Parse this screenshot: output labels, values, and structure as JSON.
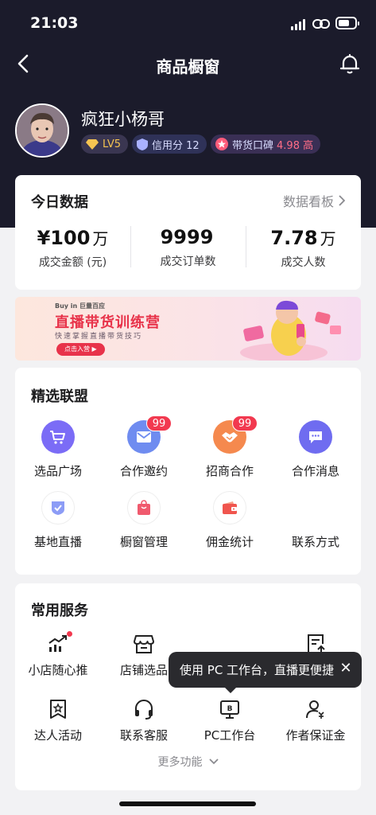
{
  "status_bar": {
    "time": "21:03"
  },
  "nav": {
    "title": "商品橱窗"
  },
  "profile": {
    "name": "疯狂小杨哥",
    "level": "LV5",
    "credit": "信用分 12",
    "reputation_label": "带货口碑",
    "reputation_score": "4.98 高"
  },
  "today": {
    "title": "今日数据",
    "board_link": "数据看板",
    "stats": [
      {
        "value": "¥100",
        "unit": "万",
        "label": "成交金额 (元)"
      },
      {
        "value": "9999",
        "unit": "",
        "label": "成交订单数"
      },
      {
        "value": "7.78",
        "unit": "万",
        "label": "成交人数"
      }
    ]
  },
  "banner": {
    "brand": "Buy in 巨量百应",
    "headline": "直播带货训练营",
    "subtitle": "快速掌握直播带货技巧",
    "cta": "点击入营 ▶"
  },
  "alliance": {
    "title": "精选联盟",
    "items": [
      {
        "label": "选品广场",
        "icon": "cart-icon",
        "color": "#7b6cf6"
      },
      {
        "label": "合作邀约",
        "icon": "envelope-icon",
        "color": "#6f8cf0",
        "badge": "99"
      },
      {
        "label": "招商合作",
        "icon": "handshake-icon",
        "color": "#f5894e",
        "badge": "99"
      },
      {
        "label": "合作消息",
        "icon": "chat-icon",
        "color": "#6f6cf0"
      },
      {
        "label": "基地直播",
        "icon": "shield-check-icon",
        "color": "#7b8cf6"
      },
      {
        "label": "橱窗管理",
        "icon": "bag-icon",
        "color": "#f05a6e"
      },
      {
        "label": "佣金统计",
        "icon": "wallet-icon",
        "color": "#f0554e"
      },
      {
        "label": "联系方式",
        "icon": "",
        "color": ""
      }
    ]
  },
  "services": {
    "title": "常用服务",
    "items": [
      {
        "label": "小店随心推",
        "icon": "trend-icon",
        "dot": true
      },
      {
        "label": "店铺选品",
        "icon": "store-icon"
      },
      {
        "label": "",
        "icon": ""
      },
      {
        "label": "",
        "icon": "clipboard-upload-icon"
      },
      {
        "label": "达人活动",
        "icon": "star-badge-icon"
      },
      {
        "label": "联系客服",
        "icon": "headset-icon"
      },
      {
        "label": "PC工作台",
        "icon": "monitor-icon"
      },
      {
        "label": "作者保证金",
        "icon": "user-yen-icon"
      }
    ],
    "more": "更多功能"
  },
  "tooltip": {
    "text": "使用 PC 工作台，直播更便捷",
    "close": "✕"
  }
}
